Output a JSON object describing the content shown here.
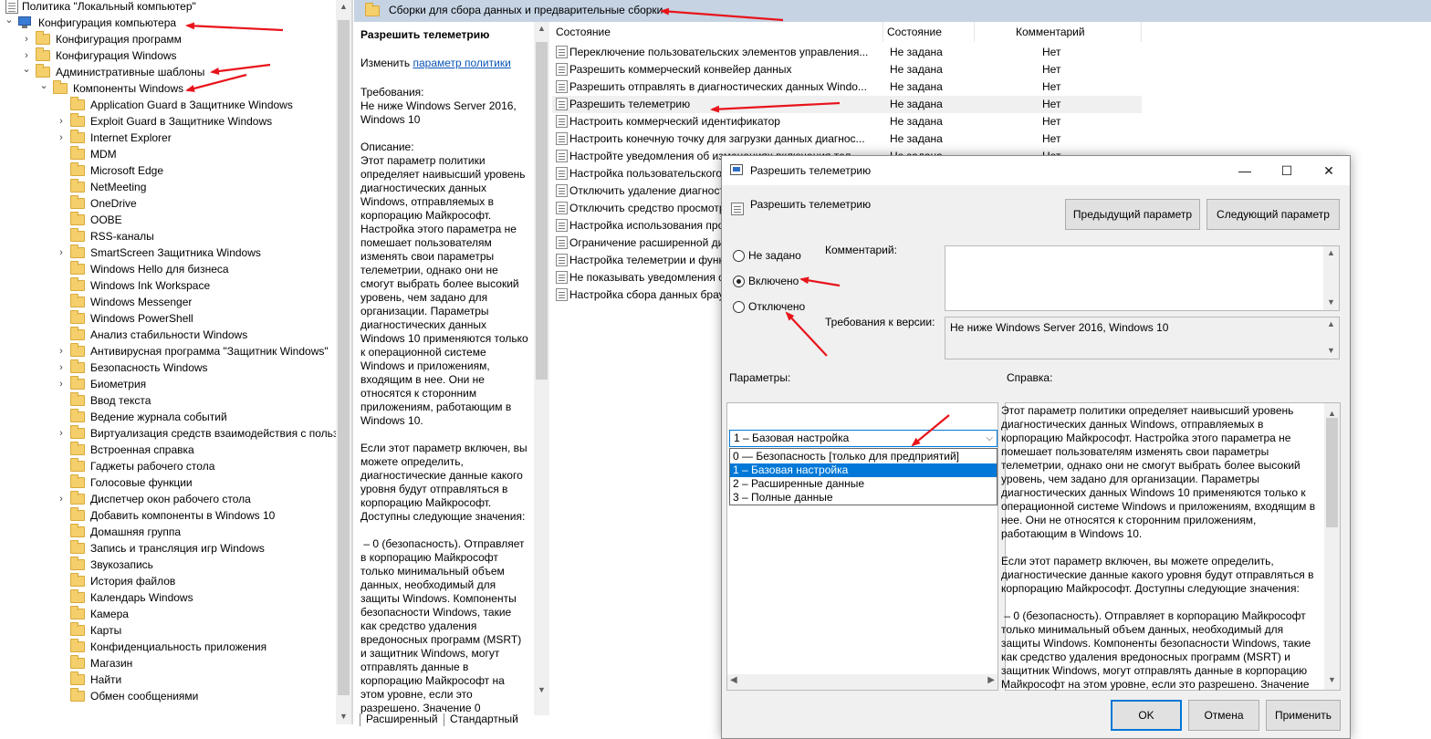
{
  "tree": {
    "items": [
      {
        "label": "Политика \"Локальный компьютер\"",
        "expander": "",
        "icon": "doc"
      },
      {
        "label": "Конфигурация компьютера",
        "expander": "expanded",
        "icon": "pc"
      },
      {
        "label": "Конфигурация программ",
        "expander": "collapsed",
        "icon": "folder"
      },
      {
        "label": "Конфигурация Windows",
        "expander": "collapsed",
        "icon": "folder"
      },
      {
        "label": "Административные шаблоны",
        "expander": "expanded",
        "icon": "folder"
      },
      {
        "label": "Компоненты Windows",
        "expander": "expanded",
        "icon": "folder"
      },
      {
        "label": "Application Guard в Защитнике Windows",
        "expander": "",
        "icon": "folder"
      },
      {
        "label": "Exploit Guard в Защитнике Windows",
        "expander": "collapsed",
        "icon": "folder"
      },
      {
        "label": "Internet Explorer",
        "expander": "collapsed",
        "icon": "folder"
      },
      {
        "label": "MDM",
        "expander": "",
        "icon": "folder"
      },
      {
        "label": "Microsoft Edge",
        "expander": "",
        "icon": "folder"
      },
      {
        "label": "NetMeeting",
        "expander": "",
        "icon": "folder"
      },
      {
        "label": "OneDrive",
        "expander": "",
        "icon": "folder"
      },
      {
        "label": "OOBE",
        "expander": "",
        "icon": "folder"
      },
      {
        "label": "RSS-каналы",
        "expander": "",
        "icon": "folder"
      },
      {
        "label": "SmartScreen Защитника Windows",
        "expander": "collapsed",
        "icon": "folder"
      },
      {
        "label": "Windows Hello для бизнеса",
        "expander": "",
        "icon": "folder"
      },
      {
        "label": "Windows Ink Workspace",
        "expander": "",
        "icon": "folder"
      },
      {
        "label": "Windows Messenger",
        "expander": "",
        "icon": "folder"
      },
      {
        "label": "Windows PowerShell",
        "expander": "",
        "icon": "folder"
      },
      {
        "label": "Анализ стабильности Windows",
        "expander": "",
        "icon": "folder"
      },
      {
        "label": "Антивирусная программа \"Защитник Windows\"",
        "expander": "collapsed",
        "icon": "folder"
      },
      {
        "label": "Безопасность Windows",
        "expander": "collapsed",
        "icon": "folder"
      },
      {
        "label": "Биометрия",
        "expander": "collapsed",
        "icon": "folder"
      },
      {
        "label": "Ввод текста",
        "expander": "",
        "icon": "folder"
      },
      {
        "label": "Ведение журнала событий",
        "expander": "",
        "icon": "folder"
      },
      {
        "label": "Виртуализация средств взаимодействия с польз",
        "expander": "collapsed",
        "icon": "folder"
      },
      {
        "label": "Встроенная справка",
        "expander": "",
        "icon": "folder"
      },
      {
        "label": "Гаджеты рабочего стола",
        "expander": "",
        "icon": "folder"
      },
      {
        "label": "Голосовые функции",
        "expander": "",
        "icon": "folder"
      },
      {
        "label": "Диспетчер окон рабочего стола",
        "expander": "collapsed",
        "icon": "folder"
      },
      {
        "label": "Добавить компоненты в Windows 10",
        "expander": "",
        "icon": "folder"
      },
      {
        "label": "Домашняя группа",
        "expander": "",
        "icon": "folder"
      },
      {
        "label": "Запись и трансляция игр Windows",
        "expander": "",
        "icon": "folder"
      },
      {
        "label": "Звукозапись",
        "expander": "",
        "icon": "folder"
      },
      {
        "label": "История файлов",
        "expander": "",
        "icon": "folder"
      },
      {
        "label": "Календарь Windows",
        "expander": "",
        "icon": "folder"
      },
      {
        "label": "Камера",
        "expander": "",
        "icon": "folder"
      },
      {
        "label": "Карты",
        "expander": "",
        "icon": "folder"
      },
      {
        "label": "Конфиденциальность приложения",
        "expander": "",
        "icon": "folder"
      },
      {
        "label": "Магазин",
        "expander": "",
        "icon": "folder"
      },
      {
        "label": "Найти",
        "expander": "",
        "icon": "folder"
      },
      {
        "label": "Обмен сообщениями",
        "expander": "",
        "icon": "folder"
      }
    ]
  },
  "pathbar": {
    "title": "Сборки для сбора данных и предварительные сборки"
  },
  "details": {
    "title": "Разрешить телеметрию",
    "edit_prefix": "Изменить ",
    "edit_link": "параметр политики",
    "text": "Требования:\nНе ниже Windows Server 2016, Windows 10\n\nОписание:\nЭтот параметр политики определяет наивысший уровень диагностических данных Windows, отправляемых в корпорацию Майкрософт. Настройка этого параметра не помешает пользователям изменять свои параметры телеметрии, однако они не смогут выбрать более высокий уровень, чем задано для организации. Параметры диагностических данных Windows 10 применяются только к операционной системе Windows и приложениям, входящим в нее. Они не относятся к сторонним приложениям, работающим в Windows 10.\n\nЕсли этот параметр включен, вы можете определить, диагностические данные какого уровня будут отправляться в корпорацию Майкрософт. Доступны следующие значения:\n\n – 0 (безопасность). Отправляет в корпорацию Майкрософт только минимальный объем данных, необходимый для защиты Windows. Компоненты безопасности Windows, такие как средство удаления вредоносных программ (MSRT) и защитник Windows, могут отправлять данные в корпорацию Майкрософт на этом уровне, если это разрешено. Значение 0"
  },
  "tabs": [
    "Расширенный",
    "Стандартный"
  ],
  "list": {
    "columns": [
      "Состояние",
      "Состояние",
      "Комментарий"
    ],
    "rows": [
      {
        "name": "Переключение пользовательских элементов управления...",
        "state": "Не задана",
        "comment": "Нет"
      },
      {
        "name": "Разрешить коммерческий конвейер данных",
        "state": "Не задана",
        "comment": "Нет"
      },
      {
        "name": "Разрешить отправлять в диагностических данных Windo...",
        "state": "Не задана",
        "comment": "Нет"
      },
      {
        "name": "Разрешить телеметрию",
        "state": "Не задана",
        "comment": "Нет"
      },
      {
        "name": "Настроить коммерческий идентификатор",
        "state": "Не задана",
        "comment": "Нет"
      },
      {
        "name": "Настроить конечную точку для загрузки данных диагнос...",
        "state": "Не задана",
        "comment": "Нет"
      },
      {
        "name": "Настройте уведомления об изменениях включения тел...",
        "state": "Не задана",
        "comment": "Нет"
      },
      {
        "name": "Настройка пользовательского",
        "state": "",
        "comment": ""
      },
      {
        "name": "Отключить удаление диагност",
        "state": "",
        "comment": ""
      },
      {
        "name": "Отключить средство просмотр",
        "state": "",
        "comment": ""
      },
      {
        "name": "Настройка использования прок",
        "state": "",
        "comment": ""
      },
      {
        "name": "Ограничение расширенной ди",
        "state": "",
        "comment": ""
      },
      {
        "name": "Настройка телеметрии и функ",
        "state": "",
        "comment": ""
      },
      {
        "name": "Не показывать уведомления о",
        "state": "",
        "comment": ""
      },
      {
        "name": "Настройка сбора данных брау",
        "state": "",
        "comment": ""
      }
    ]
  },
  "dialog": {
    "title": "Разрешить телеметрию",
    "header": "Разрешить телеметрию",
    "prev_button": "Предыдущий параметр",
    "next_button": "Следующий параметр",
    "radio_not_set": "Не задано",
    "radio_enabled": "Включено",
    "radio_disabled": "Отключено",
    "comment_label": "Комментарий:",
    "requirements_label": "Требования к версии:",
    "requirements_value": "Не ниже Windows Server 2016, Windows 10",
    "params_label": "Параметры:",
    "help_label": "Справка:",
    "combo_value": "1 – Базовая настройка",
    "options": [
      "0 — Безопасность [только для предприятий]",
      "1 – Базовая настройка",
      "2 – Расширенные данные",
      "3 – Полные данные"
    ],
    "help_text": "Этот параметр политики определяет наивысший уровень диагностических данных Windows, отправляемых в корпорацию Майкрософт. Настройка этого параметра не помешает пользователям изменять свои параметры телеметрии, однако они не смогут выбрать более высокий уровень, чем задано для организации. Параметры диагностических данных Windows 10 применяются только к операционной системе Windows и приложениям, входящим в нее. Они не относятся к сторонним приложениям, работающим в Windows 10.\n\nЕсли этот параметр включен, вы можете определить, диагностические данные какого уровня будут отправляться в корпорацию Майкрософт. Доступны следующие значения:\n\n – 0 (безопасность). Отправляет в корпорацию Майкрософт только минимальный объем данных, необходимый для защиты Windows. Компоненты безопасности Windows, такие как средство удаления вредоносных программ (MSRT) и защитник Windows, могут отправлять данные в корпорацию Майкрософт на этом уровне, если это разрешено. Значение",
    "ok": "OK",
    "cancel": "Отмена",
    "apply": "Применить"
  },
  "colors": {
    "accent": "#0078d7",
    "pathbar": "#c5d3e3",
    "annotation": "#e8141b"
  }
}
